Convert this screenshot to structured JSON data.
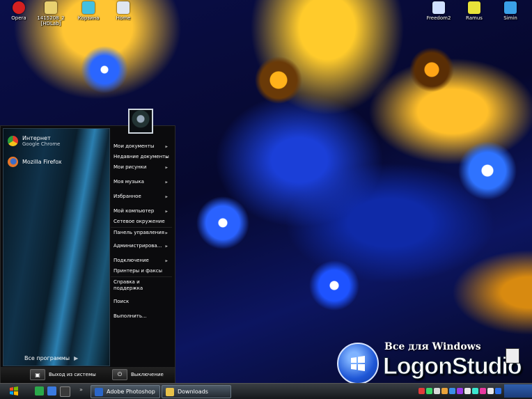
{
  "desktop": {
    "icons": [
      {
        "label": "Opera",
        "color": "#d42020"
      },
      {
        "label": "1415208_2 [HDLab]",
        "color": "#e8d070"
      },
      {
        "label": "Корзина",
        "color": "#44c0e0"
      },
      {
        "label": "Home",
        "color": "#dfe6f0"
      },
      {
        "label": "Freedom2",
        "color": "#d0e0ff"
      },
      {
        "label": "Ramus",
        "color": "#e8e23a"
      },
      {
        "label": "Simin",
        "color": "#3aa0e8"
      }
    ]
  },
  "start_menu": {
    "pinned": [
      {
        "name": "Интернет",
        "sub": "Google Chrome",
        "icon": "chrome-icon"
      },
      {
        "name": "Mozilla Firefox",
        "sub": "",
        "icon": "firefox-icon"
      }
    ],
    "all_programs": "Все программы",
    "right_items": [
      {
        "label": "Мои документы",
        "arrow": true
      },
      {
        "label": "Недавние документы",
        "arrow": true
      },
      {
        "label": "Мои рисунки",
        "arrow": true
      },
      {
        "label": "Моя музыка",
        "arrow": true
      },
      {
        "label": "Избранное",
        "arrow": true
      },
      {
        "label": "Мой компьютер",
        "arrow": true
      },
      {
        "label": "Сетевое окружение",
        "arrow": false
      },
      {
        "label": "Панель управления",
        "arrow": true
      },
      {
        "label": "Администрирова...",
        "arrow": true
      },
      {
        "label": "Подключение",
        "arrow": true
      },
      {
        "label": "Принтеры и факсы",
        "arrow": false
      },
      {
        "label": "Справка и поддержка",
        "arrow": false
      },
      {
        "label": "Поиск",
        "arrow": false
      },
      {
        "label": "Выполнить...",
        "arrow": false
      }
    ],
    "logoff": "Выход из системы",
    "shutdown": "Выключение"
  },
  "taskbar": {
    "tasks": [
      {
        "label": "Adobe Photoshop",
        "color": "#2a66c8"
      },
      {
        "label": "Downloads",
        "color": "#e8c24a"
      }
    ],
    "tray_colors": [
      "#e23a3a",
      "#3ad86b",
      "#d8d8d8",
      "#e8a23a",
      "#3a8ee8",
      "#9a3ae8",
      "#e8e8e8",
      "#3ae8d0",
      "#e83aa0",
      "#e8e8e8",
      "#2a6ee8"
    ]
  },
  "watermark": {
    "title": "Все для Windows",
    "brand": "LogonStudio"
  },
  "colors": {
    "menu_bg": "#0b0b0d",
    "taskbar_top": "#3a3f44"
  }
}
